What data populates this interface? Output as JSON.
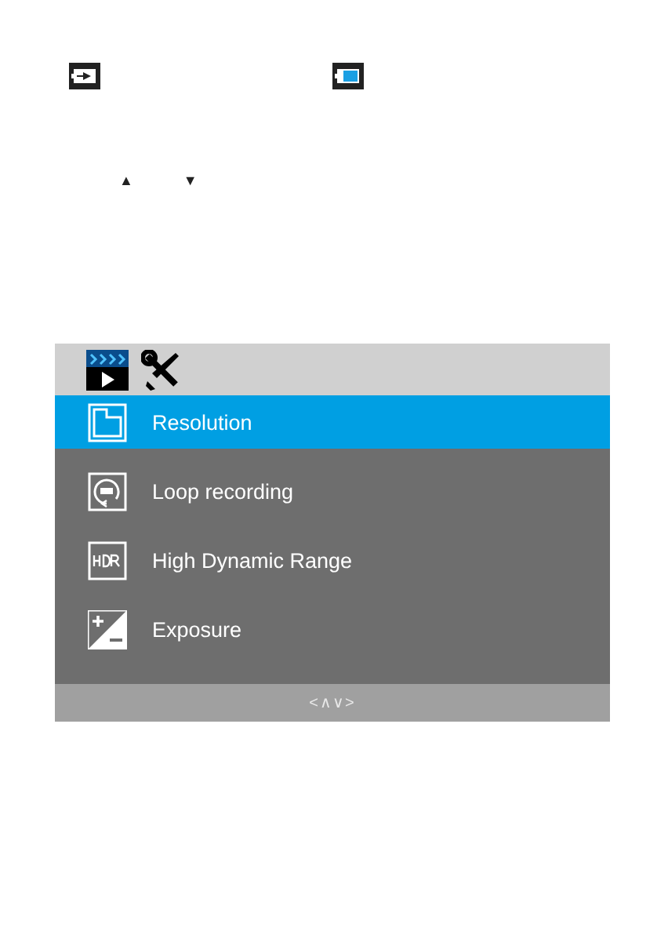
{
  "page_arrows": [
    "▲",
    "▼"
  ],
  "menu": {
    "tabs": [
      {
        "kind": "video",
        "selected": true
      },
      {
        "kind": "setup",
        "selected": false
      }
    ],
    "items": [
      {
        "kind": "resolution",
        "label": "Resolution",
        "selected": true
      },
      {
        "kind": "loop",
        "label": "Loop recording",
        "selected": false
      },
      {
        "kind": "hdr",
        "label": "High Dynamic Range",
        "selected": false
      },
      {
        "kind": "exposure",
        "label": "Exposure",
        "selected": false
      }
    ],
    "footer_hint": "<∧∨>"
  }
}
